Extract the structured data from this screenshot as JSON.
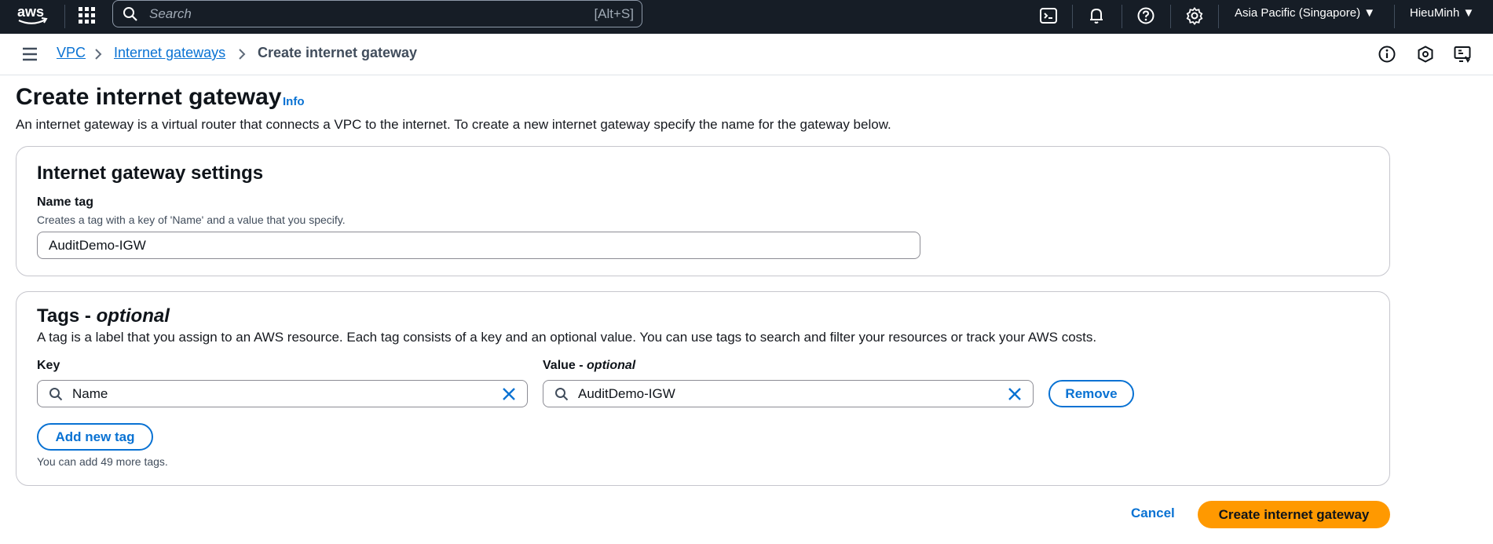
{
  "topbar": {
    "logo_text": "aws",
    "search_placeholder": "Search",
    "search_shortcut": "[Alt+S]",
    "region": "Asia Pacific (Singapore) ▼",
    "user": "HieuMinh ▼",
    "icons": [
      "apps-grid-icon",
      "cloudshell-icon",
      "notifications-bell-icon",
      "help-icon",
      "settings-gear-icon"
    ]
  },
  "breadcrumb": {
    "items": [
      "VPC",
      "Internet gateways",
      "Create internet gateway"
    ]
  },
  "header": {
    "title": "Create internet gateway",
    "info": "Info",
    "description": "An internet gateway is a virtual router that connects a VPC to the internet. To create a new internet gateway specify the name for the gateway below."
  },
  "settings_panel": {
    "title": "Internet gateway settings",
    "name_tag_label": "Name tag",
    "name_tag_hint": "Creates a tag with a key of 'Name' and a value that you specify.",
    "name_tag_value": "AuditDemo-IGW"
  },
  "tags_panel": {
    "title_main": "Tags - ",
    "title_em": "optional",
    "description": "A tag is a label that you assign to an AWS resource. Each tag consists of a key and an optional value. You can use tags to search and filter your resources or track your AWS costs.",
    "key_label": "Key",
    "value_label_main": "Value - ",
    "value_label_em": "optional",
    "rows": [
      {
        "key": "Name",
        "value": "AuditDemo-IGW"
      }
    ],
    "remove_label": "Remove",
    "add_label": "Add new tag",
    "limit_hint": "You can add 49 more tags."
  },
  "actions": {
    "cancel": "Cancel",
    "create": "Create internet gateway"
  },
  "colors": {
    "nav_bg": "#161d26",
    "link": "#0972d3",
    "primary": "#ff9900"
  }
}
